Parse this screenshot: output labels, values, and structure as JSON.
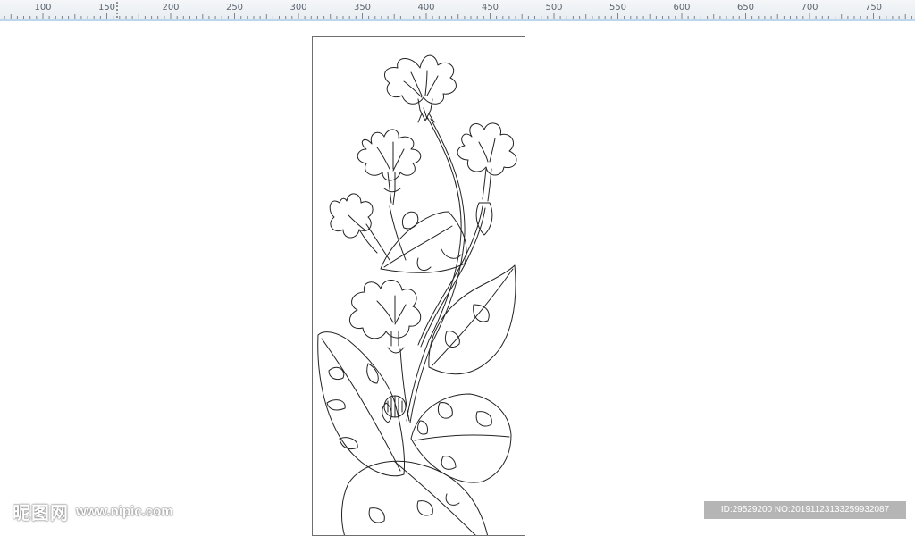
{
  "ruler": {
    "labels": [
      "100",
      "150",
      "200",
      "250",
      "300",
      "350",
      "400",
      "450",
      "500",
      "550",
      "600",
      "650",
      "700",
      "750"
    ],
    "unit_step": 50
  },
  "artboard": {
    "drawing": "floral-line-art"
  },
  "watermark": {
    "logo_text": "昵图网",
    "url": "www.nipic.com",
    "id_text": "ID:29529200 NO:20191123133259932087"
  },
  "colors": {
    "ruler_bg": "#eef1f4",
    "ruler_accent": "#bcd6ee",
    "stroke": "#222222",
    "artboard_border": "#6e6e6e"
  }
}
